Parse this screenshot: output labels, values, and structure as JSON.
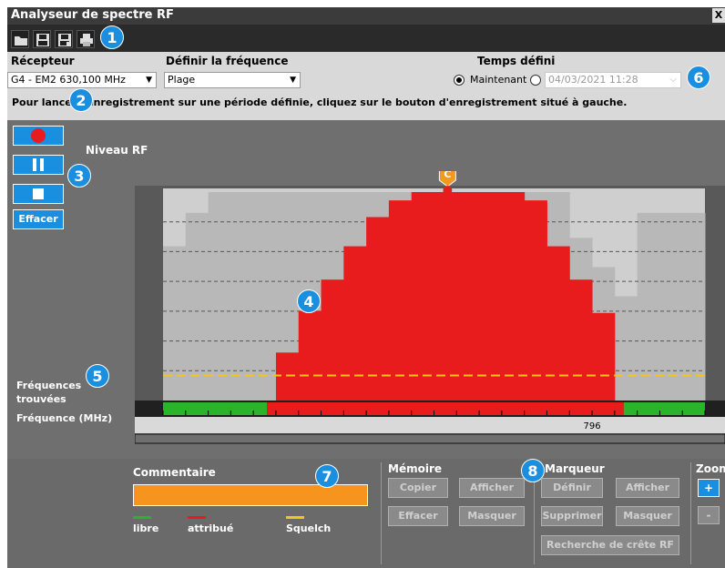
{
  "window": {
    "title": "Analyseur de spectre RF",
    "close_label": "X"
  },
  "toolbar": {
    "buttons": [
      {
        "name": "open-folder",
        "icon": "folder-icon"
      },
      {
        "name": "save",
        "icon": "save-icon"
      },
      {
        "name": "save-as",
        "icon": "save-as-icon"
      },
      {
        "name": "print",
        "icon": "print-icon"
      }
    ]
  },
  "options": {
    "receiver_label": "Récepteur",
    "receiver_value": "G4 - EM2 630,100 MHz",
    "frequency_label": "Définir la fréquence",
    "frequency_value": "Plage",
    "time_label": "Temps défini",
    "now_label": "Maintenant",
    "now_selected": true,
    "datetime_value": "04/03/2021 11:28",
    "instruction": "Pour lancer l'enregistrement sur une période définie, cliquez sur le bouton d'enregistrement situé à gauche."
  },
  "badges": [
    "1",
    "2",
    "3",
    "4",
    "5",
    "6",
    "7",
    "8"
  ],
  "controls": {
    "record_icon": "record-icon",
    "pause_icon": "pause-icon",
    "stop_icon": "stop-icon",
    "clear_label": "Effacer"
  },
  "chart_labels": {
    "rf_level": "Niveau RF",
    "found_freq": "Fréquences trouvées",
    "freq_mhz": "Fréquence (MHz)",
    "marker_label": "C"
  },
  "chart_data": {
    "type": "area",
    "ylabel": "Niveau RF",
    "xlabel": "Fréquence (MHz)",
    "x_tick_labels": [
      "796"
    ],
    "x_index_range": [
      0,
      24
    ],
    "y_range": [
      0,
      10
    ],
    "grid": true,
    "squelch_level": 1.2,
    "marker": {
      "label": "C",
      "x_index": 12.6
    },
    "gray_envelope": [
      7.4,
      9.0,
      10,
      10,
      10,
      10,
      10,
      10,
      10,
      10,
      10,
      10,
      10,
      10,
      10,
      10,
      10,
      10,
      7.8,
      6.4,
      5.0,
      9.0,
      9.0,
      9.0
    ],
    "red_spectrum": [
      0,
      0,
      0,
      0,
      0,
      2.3,
      4.3,
      5.8,
      7.4,
      8.8,
      9.6,
      10,
      10,
      10,
      10,
      10,
      9.6,
      7.4,
      5.8,
      4.2,
      0,
      0,
      0,
      0
    ],
    "occupancy": {
      "green_range": [
        0,
        4.6
      ],
      "red_range": [
        4.6,
        20.4
      ],
      "green2_range": [
        20.4,
        24
      ]
    },
    "legend": [
      {
        "label": "libre",
        "color": "#2bb32b"
      },
      {
        "label": "attribué",
        "color": "#e81c1c"
      },
      {
        "label": "Squelch",
        "color": "#f5c518"
      }
    ]
  },
  "bottom": {
    "comment_title": "Commentaire",
    "memory_title": "Mémoire",
    "memory_buttons": [
      "Copier",
      "Afficher",
      "Effacer",
      "Masquer"
    ],
    "marker_title": "Marqueur",
    "marker_buttons": [
      "Définir",
      "Afficher",
      "Supprimer",
      "Masquer",
      "Recherche de crête RF"
    ],
    "zoom_title": "Zoom",
    "zoom_in": "+",
    "zoom_out": "-"
  },
  "colors": {
    "accent": "#1a8fe0",
    "spectrum_red": "#e81c1c",
    "squelch": "#f5c518",
    "comment": "#f7941d"
  }
}
